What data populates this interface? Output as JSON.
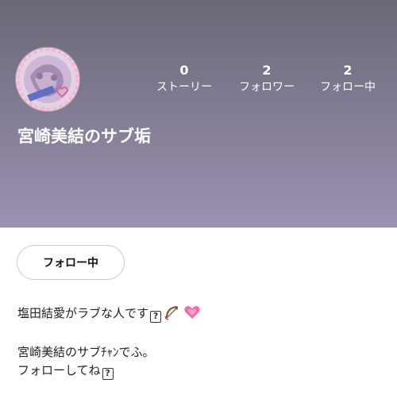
{
  "profile": {
    "name": "宮崎美結のサブ垢",
    "stats": [
      {
        "value": "0",
        "label": "ストーリー"
      },
      {
        "value": "2",
        "label": "フォロワー"
      },
      {
        "value": "2",
        "label": "フォロー中"
      }
    ]
  },
  "follow_button": {
    "label": "フォロー中"
  },
  "bio": {
    "line1": "塩田結愛がラブな人です",
    "line2": "宮崎美結のサブﾁｬﾝでふ。",
    "line3": "フォローしてね",
    "missing_glyph": "?",
    "icons": [
      "bow-and-arrow-icon",
      "growing-heart-icon"
    ]
  },
  "colors": {
    "header_top": "#6c6876",
    "header_bottom": "#9b92b0",
    "heart": "#f26aa8"
  }
}
